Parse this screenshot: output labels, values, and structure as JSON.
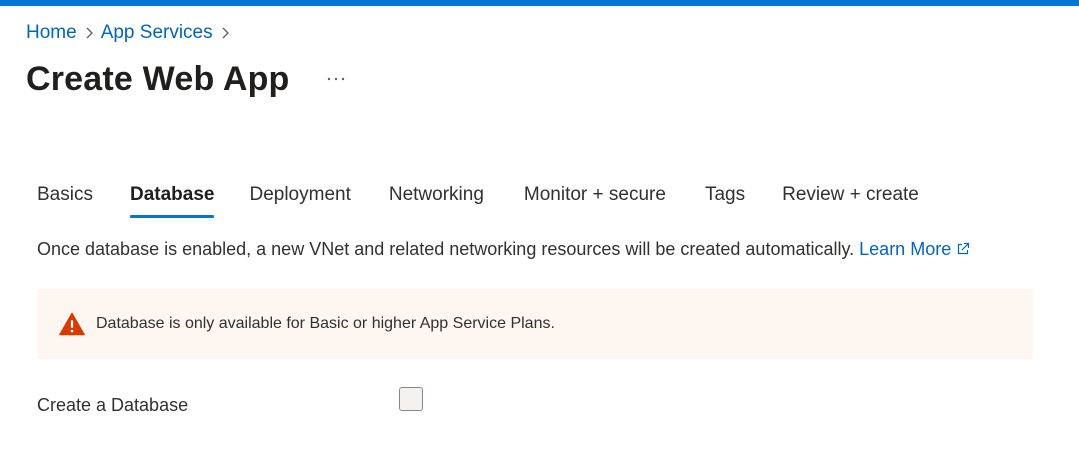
{
  "breadcrumb": {
    "items": [
      "Home",
      "App Services"
    ]
  },
  "page": {
    "title": "Create Web App",
    "more_icon": "ellipsis-icon"
  },
  "tabs": [
    {
      "label": "Basics",
      "active": false
    },
    {
      "label": "Database",
      "active": true
    },
    {
      "label": "Deployment",
      "active": false
    },
    {
      "label": "Networking",
      "active": false
    },
    {
      "label": "Monitor + secure",
      "active": false
    },
    {
      "label": "Tags",
      "active": false
    },
    {
      "label": "Review + create",
      "active": false
    }
  ],
  "info": {
    "text": "Once database is enabled, a new VNet and related networking resources will be created automatically.",
    "link": "Learn More",
    "link_icon": "external-link-icon"
  },
  "warning": {
    "icon": "warning-icon",
    "text": "Database is only available for Basic or higher App Service Plans.",
    "background": "#fdf6f1",
    "icon_color": "#d83b01"
  },
  "form": {
    "create_database_label": "Create a Database",
    "create_database_checked": false
  },
  "colors": {
    "accent": "#0078d4",
    "link": "#0066b8"
  }
}
